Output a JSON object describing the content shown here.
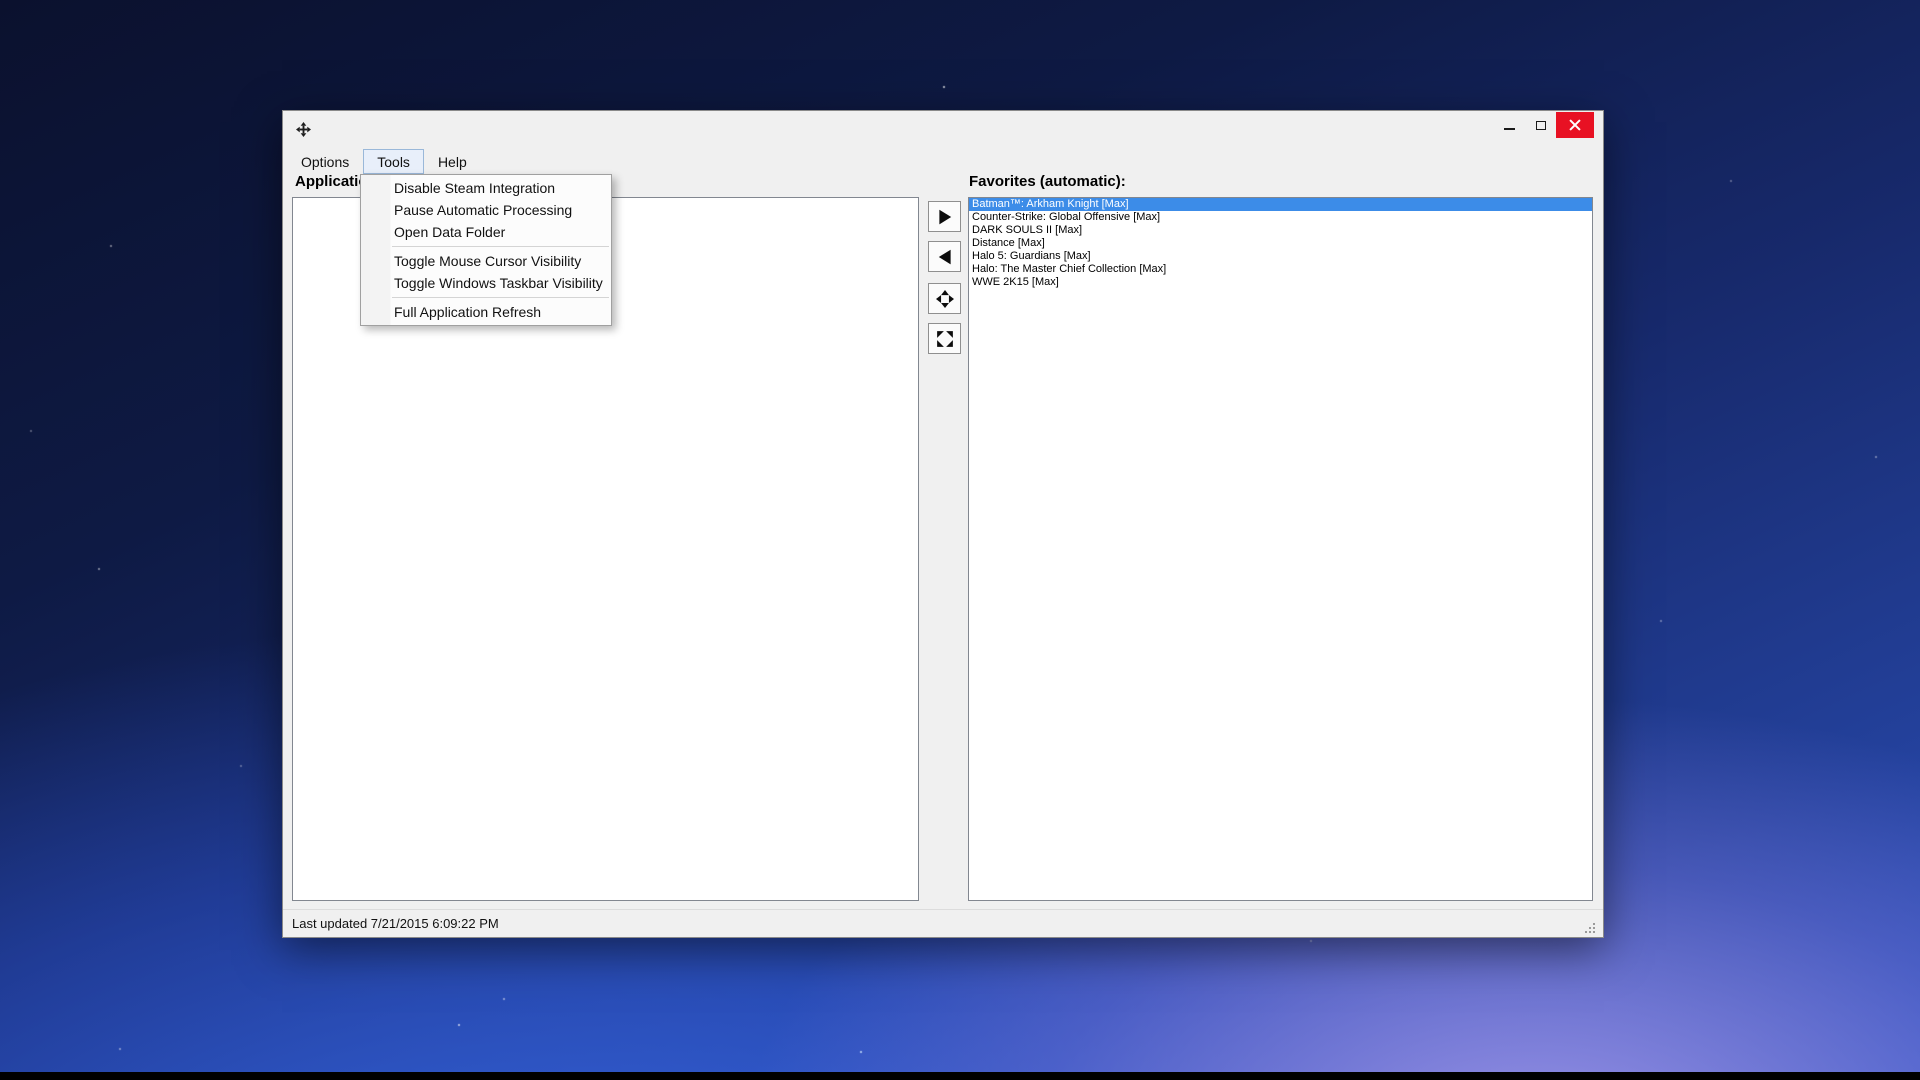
{
  "desktop": {
    "background_colors": [
      "#0b112e",
      "#17296b",
      "#2c52c0",
      "#9e94e8"
    ],
    "taskbar_strip_color": "#000000"
  },
  "window": {
    "titlebar": {
      "app_icon": "move-arrows-icon",
      "minimize_icon": "minimize-icon",
      "maximize_icon": "maximize-icon",
      "close_icon": "close-icon",
      "close_button_color": "#e81123"
    },
    "menubar": {
      "items": [
        "Options",
        "Tools",
        "Help"
      ],
      "open_item": "Tools"
    },
    "tools_menu": {
      "items": [
        "Disable Steam Integration",
        "Pause Automatic Processing",
        "Open Data Folder",
        "Toggle Mouse Cursor Visibility",
        "Toggle Windows Taskbar Visibility",
        "Full Application Refresh"
      ]
    },
    "applications_panel": {
      "label": "Applications:",
      "items": []
    },
    "transfer_buttons": {
      "add_icon": "right-triangle-icon",
      "remove_icon": "left-triangle-icon",
      "center_icon": "arrows-out-cardinal-icon",
      "fullscreen_icon": "arrows-out-diagonal-icon"
    },
    "favorites_panel": {
      "label": "Favorites (automatic):",
      "selected_index": 0,
      "selection_color": "#3c8ce8",
      "items": [
        "Batman™: Arkham Knight [Max]",
        "Counter-Strike: Global Offensive [Max]",
        "DARK SOULS II [Max]",
        "Distance [Max]",
        "Halo 5: Guardians [Max]",
        "Halo: The Master Chief Collection [Max]",
        "WWE 2K15 [Max]"
      ]
    },
    "statusbar": {
      "text": "Last updated 7/21/2015 6:09:22 PM"
    }
  }
}
